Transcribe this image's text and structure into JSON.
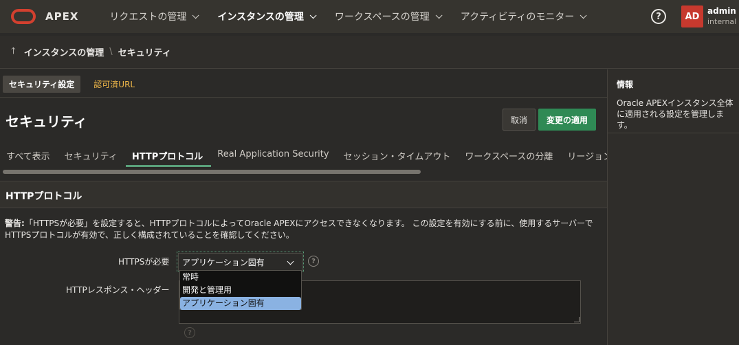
{
  "app": {
    "name": "APEX"
  },
  "nav": {
    "items": [
      {
        "label": "リクエストの管理"
      },
      {
        "label": "インスタンスの管理"
      },
      {
        "label": "ワークスペースの管理"
      },
      {
        "label": "アクティビティのモニター"
      }
    ],
    "help": "?",
    "user": {
      "initials": "AD",
      "name": "admin",
      "role": "internal"
    }
  },
  "breadcrumb": {
    "parent": "インスタンスの管理",
    "sep": "\\",
    "current": "セキュリティ"
  },
  "subtabs": {
    "active": "セキュリティ設定",
    "link": "認可済URL"
  },
  "page": {
    "title": "セキュリティ",
    "cancel": "取消",
    "apply": "変更の適用"
  },
  "tabs": [
    {
      "label": "すべて表示"
    },
    {
      "label": "セキュリティ"
    },
    {
      "label": "HTTPプロトコル"
    },
    {
      "label": "Real Application Security"
    },
    {
      "label": "セッション・タイムアウト"
    },
    {
      "label": "ワークスペースの分離"
    },
    {
      "label": "リージョンおよびWeb"
    }
  ],
  "section": {
    "title": "HTTPプロトコル",
    "warning_label": "警告:",
    "warning_text": "「HTTPSが必要」を設定すると、HTTPプロトコルによってOracle APEXにアクセスできなくなります。 この設定を有効にする前に、使用するサーバーでHTTPSプロトコルが有効で、正しく構成されていることを確認してください。",
    "https_label": "HTTPSが必要",
    "https_value": "アプリケーション固有",
    "https_options": [
      "常時",
      "開発と管理用",
      "アプリケーション固有"
    ],
    "header_label": "HTTPレスポンス・ヘッダー",
    "header_value": ""
  },
  "info": {
    "title": "情報",
    "body": "Oracle APEXインスタンス全体に適用される設定を管理します。"
  },
  "colors": {
    "accent_green": "#2f8a55",
    "brand_red": "#c7392e",
    "link": "#f0b849",
    "selected_option": "#8ab2e2"
  }
}
